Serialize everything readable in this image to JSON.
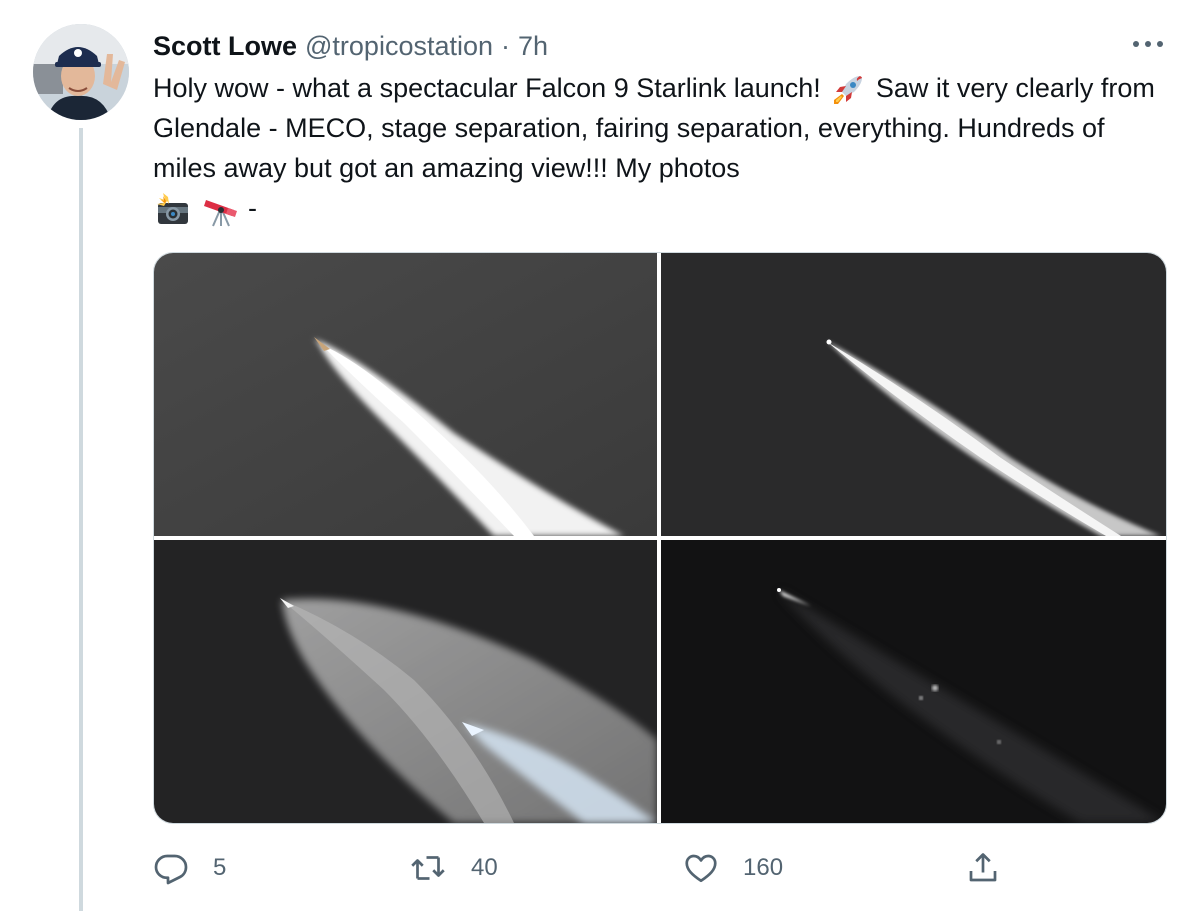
{
  "tweet": {
    "author_name": "Scott Lowe",
    "handle": "@tropicostation",
    "separator": "·",
    "time": "7h",
    "text_part1": "Holy wow - what a spectacular Falcon 9 Starlink launch!",
    "text_part2": "Saw it very clearly from Glendale - MECO, stage separation, fairing separation, everything. Hundreds of miles away but got an amazing view!!! My photos",
    "text_part3": "-",
    "emojis": [
      "rocket-emoji",
      "camera-flash-emoji",
      "telescope-emoji"
    ]
  },
  "media": {
    "photos": [
      {
        "label": "launch-photo-1"
      },
      {
        "label": "launch-photo-2"
      },
      {
        "label": "launch-photo-3"
      },
      {
        "label": "launch-photo-4"
      }
    ]
  },
  "actions": {
    "reply_count": "5",
    "retweet_count": "40",
    "like_count": "160",
    "icons": [
      "reply-icon",
      "retweet-icon",
      "like-icon",
      "share-icon"
    ]
  },
  "colors": {
    "text_primary": "#0f1419",
    "text_secondary": "#536471",
    "border": "#cfd9de"
  }
}
